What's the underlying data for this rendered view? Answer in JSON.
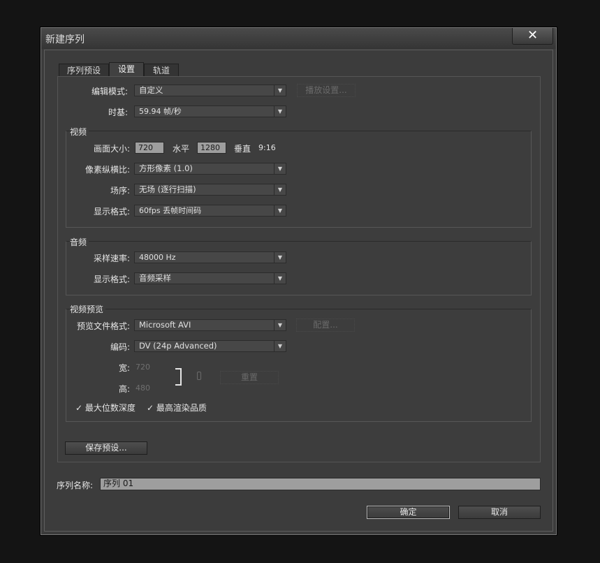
{
  "dialog": {
    "title": "新建序列",
    "close_glyph": "✕"
  },
  "tabs": [
    {
      "label": "序列预设"
    },
    {
      "label": "设置"
    },
    {
      "label": "轨道"
    }
  ],
  "top": {
    "edit_mode_label": "编辑模式:",
    "edit_mode_value": "自定义",
    "play_settings_label": "播放设置...",
    "timebase_label": "时基:",
    "timebase_value": "59.94 帧/秒"
  },
  "video": {
    "group_title": "视频",
    "frame_size_label": "画面大小:",
    "width_value": "720",
    "horizontal_label": "水平",
    "height_value": "1280",
    "vertical_label": "垂直",
    "aspect_text": "9:16",
    "pixel_aspect_label": "像素纵横比:",
    "pixel_aspect_value": "方形像素 (1.0)",
    "fields_label": "场序:",
    "fields_value": "无场 (逐行扫描)",
    "display_format_label": "显示格式:",
    "display_format_value": "60fps 丢帧时间码"
  },
  "audio": {
    "group_title": "音频",
    "sample_rate_label": "采样速率:",
    "sample_rate_value": "48000 Hz",
    "display_format_label": "显示格式:",
    "display_format_value": "音频采样"
  },
  "preview": {
    "group_title": "视频预览",
    "file_format_label": "预览文件格式:",
    "file_format_value": "Microsoft AVI",
    "configure_label": "配置...",
    "codec_label": "编码:",
    "codec_value": "DV (24p Advanced)",
    "width_label": "宽:",
    "width_value": "720",
    "height_label": "高:",
    "height_value": "480",
    "reset_label": "重置",
    "max_bit_depth_label": "最大位数深度",
    "max_render_quality_label": "最高渲染品质",
    "max_bit_depth_checked": true,
    "max_render_quality_checked": true
  },
  "save_preset_label": "保存预设...",
  "sequence_name_label": "序列名称:",
  "sequence_name_value": "序列 01",
  "ok_label": "确定",
  "cancel_label": "取消",
  "checkmark_glyph": "✓",
  "dropdown_glyph": "▼"
}
